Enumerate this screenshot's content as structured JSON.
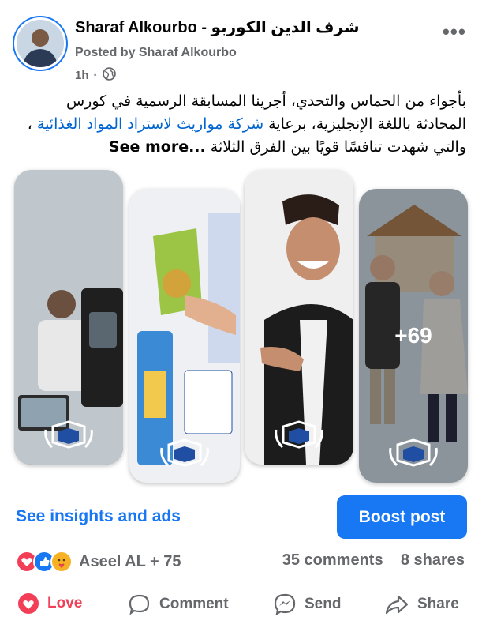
{
  "post": {
    "author": "Sharaf Alkourbo - شرف الدين الكوربو",
    "posted_by": "Posted by Sharaf Alkourbo",
    "time": "1h",
    "privacy_icon": "globe-icon",
    "more_icon": "more-options-icon",
    "text_part1": "بأجواء من الحماس والتحدي، أجرينا المسابقة الرسمية في كورس المحادثة باللغة الإنجليزية، برعاية",
    "text_link": "شركة مواريث لاستراد المواد الغذائية",
    "text_part2": "، والتي شهدت تنافسًا قويًا بين الفرق الثلاثة",
    "see_more": "See more...",
    "extra_photos": "+69"
  },
  "promo": {
    "insights_label": "See insights and ads",
    "boost_label": "Boost post"
  },
  "engagement": {
    "reaction_icons": [
      "love-icon",
      "like-icon",
      "care-icon"
    ],
    "reactions_label": "Aseel AL + 75",
    "comments": "35 comments",
    "shares": "8 shares"
  },
  "actions": {
    "love": "Love",
    "comment": "Comment",
    "send": "Send",
    "share": "Share"
  },
  "colors": {
    "brand_blue": "#1877f2",
    "love_red": "#f33e58",
    "muted_text": "#65676b"
  }
}
